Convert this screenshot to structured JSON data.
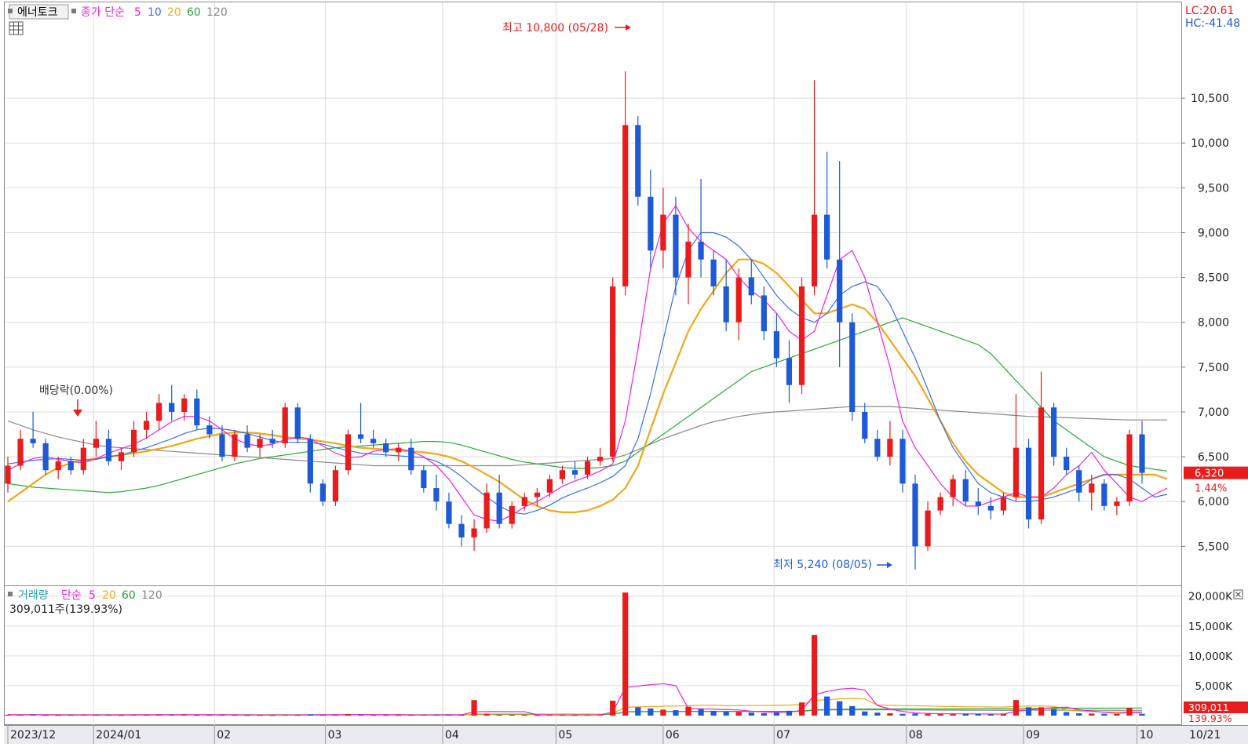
{
  "toolbar": {
    "stock_name": "에너토크",
    "price_ma_label": "종가 단순",
    "price_ma_periods": [
      "5",
      "10",
      "20",
      "60",
      "120"
    ],
    "volume_label": "거래량",
    "volume_ma_label": "단순",
    "volume_ma_periods": [
      "5",
      "20",
      "60",
      "120"
    ]
  },
  "indicators": {
    "lc": "LC:20.61",
    "hc": "HC:-41.48"
  },
  "colors": {
    "up": "#e81c1c",
    "down": "#1f5ad6",
    "ma5": "#ee22dd",
    "ma10": "#3b6ee8",
    "ma20": "#f0a818",
    "ma60": "#2aa83c",
    "ma120": "#8a8888"
  },
  "annotations": {
    "high": "최고 10,800 (05/28)",
    "low": "최저 5,240 (08/05)",
    "dividend": "배당락(0.00%)"
  },
  "last_price": {
    "price": "6,320",
    "change": "1.44%"
  },
  "volume_info": {
    "text": "309,011주(139.93%)",
    "last_volume": "309,011",
    "ratio": "139.93%"
  },
  "chart_data": {
    "type": "candlestick",
    "y_ticks": [
      "10,500",
      "10,000",
      "9,500",
      "9,000",
      "8,500",
      "8,000",
      "7,500",
      "7,000",
      "6,500",
      "6,000",
      "5,500"
    ],
    "volume_ticks": [
      "20,000K",
      "15,000K",
      "10,000K",
      "5,000K"
    ],
    "x_ticks": [
      "2023/12",
      "2024/01",
      "02",
      "03",
      "04",
      "05",
      "06",
      "07",
      "08",
      "09",
      "10"
    ],
    "x_end_label": "10/21",
    "ylim": [
      5100,
      11350
    ],
    "volume_ylim": [
      0,
      21800
    ],
    "grid": true,
    "series": [
      {
        "name": "종가",
        "ohlc": [
          [
            6200,
            6500,
            6100,
            6400
          ],
          [
            6400,
            6800,
            6350,
            6700
          ],
          [
            6700,
            7000,
            6600,
            6650
          ],
          [
            6650,
            6700,
            6300,
            6350
          ],
          [
            6350,
            6500,
            6250,
            6450
          ],
          [
            6450,
            6500,
            6300,
            6350
          ],
          [
            6350,
            6700,
            6300,
            6600
          ],
          [
            6600,
            6900,
            6500,
            6700
          ],
          [
            6700,
            6800,
            6400,
            6450
          ],
          [
            6450,
            6600,
            6350,
            6550
          ],
          [
            6550,
            6900,
            6500,
            6800
          ],
          [
            6800,
            7000,
            6700,
            6900
          ],
          [
            6900,
            7200,
            6800,
            7100
          ],
          [
            7100,
            7300,
            6900,
            7000
          ],
          [
            7000,
            7200,
            6900,
            7150
          ],
          [
            7150,
            7250,
            6800,
            6850
          ],
          [
            6850,
            6950,
            6700,
            6750
          ],
          [
            6750,
            6850,
            6450,
            6500
          ],
          [
            6500,
            6800,
            6450,
            6750
          ],
          [
            6750,
            6850,
            6550,
            6600
          ],
          [
            6600,
            6750,
            6500,
            6700
          ],
          [
            6700,
            6800,
            6600,
            6650
          ],
          [
            6650,
            7100,
            6600,
            7050
          ],
          [
            7050,
            7100,
            6650,
            6700
          ],
          [
            6700,
            6750,
            6100,
            6200
          ],
          [
            6200,
            6250,
            5950,
            6000
          ],
          [
            6000,
            6400,
            5950,
            6350
          ],
          [
            6350,
            6800,
            6300,
            6750
          ],
          [
            6750,
            7100,
            6650,
            6700
          ],
          [
            6700,
            6800,
            6600,
            6650
          ],
          [
            6650,
            6700,
            6500,
            6550
          ],
          [
            6550,
            6650,
            6450,
            6600
          ],
          [
            6600,
            6700,
            6300,
            6350
          ],
          [
            6350,
            6400,
            6100,
            6150
          ],
          [
            6150,
            6300,
            5900,
            6000
          ],
          [
            6000,
            6100,
            5700,
            5750
          ],
          [
            5750,
            5850,
            5500,
            5600
          ],
          [
            5600,
            5800,
            5450,
            5700
          ],
          [
            5700,
            6200,
            5650,
            6100
          ],
          [
            6100,
            6300,
            5700,
            5750
          ],
          [
            5750,
            6000,
            5700,
            5950
          ],
          [
            5950,
            6100,
            5900,
            6050
          ],
          [
            6050,
            6150,
            5950,
            6100
          ],
          [
            6100,
            6300,
            6050,
            6250
          ],
          [
            6250,
            6400,
            6200,
            6350
          ],
          [
            6350,
            6450,
            6250,
            6300
          ],
          [
            6300,
            6500,
            6250,
            6450
          ],
          [
            6450,
            6600,
            6400,
            6500
          ],
          [
            6500,
            8500,
            6450,
            8400
          ],
          [
            8400,
            10800,
            8300,
            10200
          ],
          [
            10200,
            10300,
            9300,
            9400
          ],
          [
            9400,
            9700,
            8600,
            8800
          ],
          [
            8800,
            9500,
            8600,
            9200
          ],
          [
            9200,
            9400,
            8300,
            8500
          ],
          [
            8500,
            9100,
            8200,
            8900
          ],
          [
            8900,
            9600,
            8500,
            8700
          ],
          [
            8700,
            8800,
            8300,
            8400
          ],
          [
            8400,
            8700,
            7900,
            8000
          ],
          [
            8000,
            8600,
            7800,
            8500
          ],
          [
            8500,
            8700,
            8200,
            8300
          ],
          [
            8300,
            8400,
            7800,
            7900
          ],
          [
            7900,
            8100,
            7500,
            7600
          ],
          [
            7600,
            7800,
            7100,
            7300
          ],
          [
            7300,
            8500,
            7200,
            8400
          ],
          [
            8400,
            10700,
            8300,
            9200
          ],
          [
            9200,
            9900,
            8600,
            8700
          ],
          [
            8700,
            9800,
            7500,
            8000
          ],
          [
            8000,
            8100,
            6900,
            7000
          ],
          [
            7000,
            7100,
            6650,
            6700
          ],
          [
            6700,
            6800,
            6450,
            6500
          ],
          [
            6500,
            6900,
            6400,
            6700
          ],
          [
            6700,
            6800,
            6100,
            6200
          ],
          [
            6200,
            6300,
            5240,
            5500
          ],
          [
            5500,
            6000,
            5450,
            5900
          ],
          [
            5900,
            6100,
            5850,
            6050
          ],
          [
            6050,
            6300,
            5950,
            6250
          ],
          [
            6250,
            6350,
            5950,
            6000
          ],
          [
            6000,
            6150,
            5850,
            5950
          ],
          [
            5950,
            6050,
            5800,
            5900
          ],
          [
            5900,
            6100,
            5850,
            6050
          ],
          [
            6050,
            7200,
            6000,
            6600
          ],
          [
            6600,
            6700,
            5700,
            5800
          ],
          [
            5800,
            7450,
            5750,
            7050
          ],
          [
            7050,
            7100,
            6400,
            6500
          ],
          [
            6500,
            6600,
            6300,
            6350
          ],
          [
            6350,
            6400,
            6000,
            6100
          ],
          [
            6100,
            6300,
            5900,
            6200
          ],
          [
            6200,
            6250,
            5900,
            5950
          ],
          [
            5950,
            6050,
            5850,
            6000
          ],
          [
            6000,
            6800,
            5950,
            6750
          ],
          [
            6750,
            6900,
            6200,
            6320
          ]
        ]
      },
      {
        "name": "거래량",
        "volume": [
          150,
          120,
          180,
          100,
          90,
          110,
          140,
          160,
          120,
          90,
          130,
          150,
          200,
          180,
          160,
          120,
          100,
          140,
          110,
          90,
          100,
          80,
          150,
          110,
          220,
          150,
          120,
          260,
          180,
          120,
          100,
          90,
          110,
          130,
          150,
          160,
          120,
          2600,
          300,
          140,
          120,
          100,
          90,
          110,
          120,
          100,
          130,
          150,
          2500,
          20600,
          1400,
          1200,
          1000,
          900,
          1500,
          1100,
          800,
          700,
          600,
          500,
          400,
          500,
          800,
          2200,
          13500,
          3200,
          2400,
          1600,
          700,
          500,
          400,
          300,
          350,
          300,
          250,
          300,
          280,
          250,
          220,
          260,
          2600,
          1400,
          1400,
          1100,
          600,
          400,
          350,
          300,
          280,
          1300,
          309
        ]
      }
    ],
    "moving_averages": {
      "ma5": [
        6350,
        6420,
        6480,
        6500,
        6470,
        6450,
        6430,
        6480,
        6540,
        6590,
        6640,
        6710,
        6800,
        6890,
        6950,
        6950,
        6900,
        6800,
        6700,
        6640,
        6620,
        6640,
        6690,
        6720,
        6700,
        6620,
        6540,
        6490,
        6500,
        6560,
        6580,
        6590,
        6560,
        6500,
        6400,
        6250,
        6050,
        5850,
        5800,
        5780,
        5850,
        5940,
        6000,
        6080,
        6170,
        6230,
        6280,
        6340,
        6420,
        6900,
        7700,
        8600,
        9100,
        9300,
        9050,
        8900,
        8800,
        8700,
        8500,
        8350,
        8250,
        8100,
        7900,
        7800,
        7900,
        8300,
        8700,
        8800,
        8500,
        8000,
        7500,
        6900,
        6600,
        6400,
        6200,
        6050,
        5950,
        5950,
        6000,
        6050,
        6100,
        6050,
        6050,
        6150,
        6300,
        6400,
        6550,
        6350,
        6200,
        6050,
        6000,
        6080,
        6150
      ],
      "ma10": [
        6420,
        6440,
        6460,
        6470,
        6480,
        6470,
        6460,
        6470,
        6500,
        6520,
        6560,
        6600,
        6650,
        6700,
        6760,
        6800,
        6820,
        6810,
        6790,
        6760,
        6720,
        6680,
        6660,
        6660,
        6660,
        6640,
        6600,
        6570,
        6540,
        6530,
        6520,
        6510,
        6500,
        6490,
        6450,
        6380,
        6280,
        6160,
        6050,
        5950,
        5880,
        5860,
        5900,
        5960,
        6040,
        6100,
        6150,
        6210,
        6280,
        6400,
        6700,
        7200,
        7800,
        8400,
        8800,
        9000,
        9000,
        8950,
        8850,
        8700,
        8500,
        8300,
        8150,
        8050,
        8000,
        8100,
        8300,
        8400,
        8450,
        8400,
        8200,
        7900,
        7600,
        7250,
        6900,
        6600,
        6400,
        6200,
        6100,
        6050,
        6000,
        6000,
        6020,
        6050,
        6100,
        6150,
        6250,
        6300,
        6300,
        6250,
        6150,
        6050,
        6080
      ],
      "ma20": [
        6000,
        6100,
        6200,
        6300,
        6380,
        6430,
        6460,
        6480,
        6500,
        6520,
        6540,
        6560,
        6590,
        6620,
        6660,
        6700,
        6730,
        6760,
        6770,
        6770,
        6760,
        6740,
        6720,
        6700,
        6690,
        6670,
        6650,
        6620,
        6600,
        6590,
        6580,
        6570,
        6560,
        6550,
        6530,
        6500,
        6450,
        6380,
        6300,
        6220,
        6120,
        6020,
        5950,
        5900,
        5880,
        5880,
        5900,
        5950,
        6020,
        6150,
        6400,
        6800,
        7200,
        7550,
        7900,
        8150,
        8350,
        8550,
        8700,
        8700,
        8650,
        8550,
        8400,
        8250,
        8100,
        8100,
        8150,
        8200,
        8150,
        8000,
        7800,
        7600,
        7400,
        7150,
        6900,
        6650,
        6450,
        6300,
        6200,
        6100,
        6050,
        6050,
        6050,
        6100,
        6150,
        6200,
        6250,
        6300,
        6300,
        6300,
        6300,
        6300,
        6250
      ],
      "ma60": [
        6200,
        6180,
        6160,
        6150,
        6140,
        6130,
        6120,
        6110,
        6100,
        6110,
        6130,
        6150,
        6180,
        6220,
        6260,
        6300,
        6340,
        6380,
        6420,
        6450,
        6480,
        6500,
        6520,
        6540,
        6560,
        6580,
        6600,
        6610,
        6620,
        6630,
        6640,
        6650,
        6660,
        6670,
        6670,
        6660,
        6630,
        6590,
        6550,
        6510,
        6470,
        6440,
        6420,
        6400,
        6380,
        6370,
        6370,
        6380,
        6400,
        6450,
        6550,
        6650,
        6750,
        6850,
        6950,
        7050,
        7150,
        7250,
        7350,
        7450,
        7500,
        7550,
        7600,
        7650,
        7700,
        7750,
        7800,
        7850,
        7900,
        7950,
        8000,
        8050,
        8000,
        7950,
        7900,
        7850,
        7800,
        7750,
        7650,
        7500,
        7350,
        7200,
        7050,
        6900,
        6800,
        6700,
        6600,
        6500,
        6450,
        6400,
        6380,
        6360,
        6340
      ],
      "ma120": [
        6900,
        6850,
        6800,
        6760,
        6720,
        6690,
        6660,
        6630,
        6610,
        6600,
        6590,
        6580,
        6570,
        6560,
        6550,
        6540,
        6530,
        6520,
        6510,
        6500,
        6490,
        6480,
        6470,
        6460,
        6450,
        6440,
        6430,
        6420,
        6410,
        6400,
        6400,
        6400,
        6400,
        6400,
        6400,
        6400,
        6400,
        6400,
        6400,
        6400,
        6400,
        6410,
        6420,
        6430,
        6440,
        6450,
        6460,
        6470,
        6480,
        6520,
        6580,
        6640,
        6700,
        6750,
        6800,
        6850,
        6890,
        6920,
        6950,
        6970,
        6990,
        7000,
        7010,
        7020,
        7030,
        7040,
        7050,
        7060,
        7060,
        7060,
        7060,
        7050,
        7040,
        7030,
        7020,
        7010,
        7000,
        6990,
        6980,
        6970,
        6960,
        6950,
        6945,
        6940,
        6935,
        6930,
        6925,
        6920,
        6915,
        6910,
        6910,
        6910,
        6910
      ]
    }
  }
}
